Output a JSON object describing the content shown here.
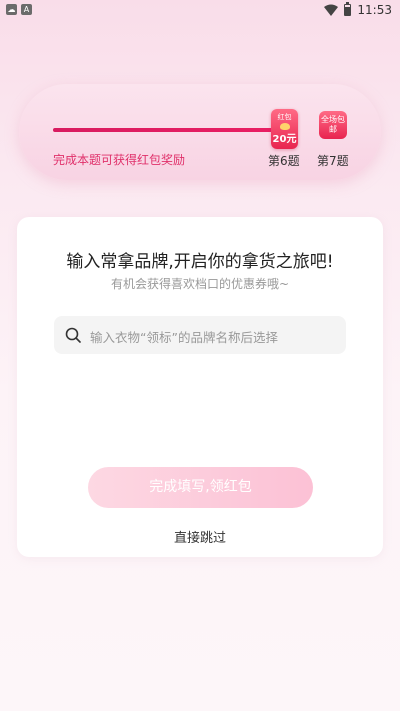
{
  "status_bar": {
    "time": "11:53",
    "app_icon_1": "☁",
    "app_icon_2": "A",
    "wifi_icon": "wifi-icon",
    "battery_icon": "battery-icon"
  },
  "progress": {
    "fraction": 0.95,
    "hint": "完成本题可获得红包奖励",
    "reward_badge": {
      "top": "红包",
      "amount": "20元"
    },
    "free_badge": "全场包邮",
    "step_6": "第6题",
    "step_7": "第7题",
    "colors": {
      "accent": "#e91e63",
      "hint": "#e0306a"
    }
  },
  "card": {
    "title": "输入常拿品牌,开启你的拿货之旅吧!",
    "subtitle": "有机会获得喜欢档口的优惠券哦~",
    "search": {
      "icon": "search-icon",
      "placeholder": "输入衣物“领标”的品牌名称后选择"
    },
    "submit_label": "完成填写,领红包",
    "skip_label": "直接跳过"
  }
}
